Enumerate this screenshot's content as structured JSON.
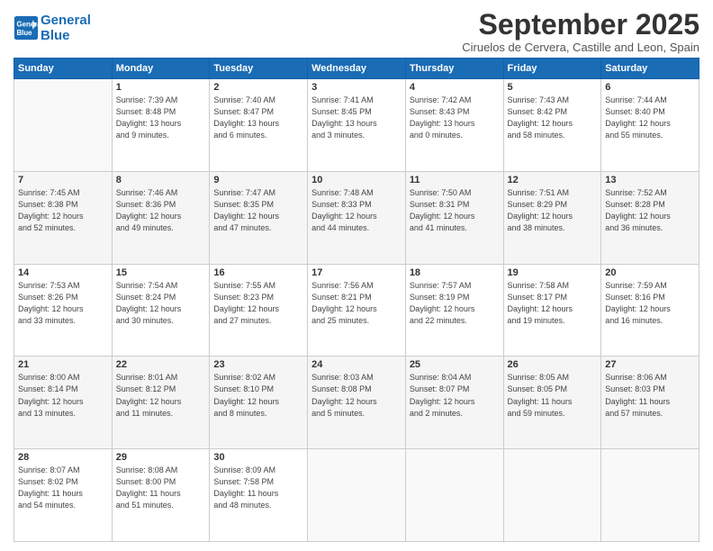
{
  "logo": {
    "line1": "General",
    "line2": "Blue"
  },
  "title": "September 2025",
  "location": "Ciruelos de Cervera, Castille and Leon, Spain",
  "weekdays": [
    "Sunday",
    "Monday",
    "Tuesday",
    "Wednesday",
    "Thursday",
    "Friday",
    "Saturday"
  ],
  "weeks": [
    [
      {
        "day": "",
        "info": ""
      },
      {
        "day": "1",
        "info": "Sunrise: 7:39 AM\nSunset: 8:48 PM\nDaylight: 13 hours\nand 9 minutes."
      },
      {
        "day": "2",
        "info": "Sunrise: 7:40 AM\nSunset: 8:47 PM\nDaylight: 13 hours\nand 6 minutes."
      },
      {
        "day": "3",
        "info": "Sunrise: 7:41 AM\nSunset: 8:45 PM\nDaylight: 13 hours\nand 3 minutes."
      },
      {
        "day": "4",
        "info": "Sunrise: 7:42 AM\nSunset: 8:43 PM\nDaylight: 13 hours\nand 0 minutes."
      },
      {
        "day": "5",
        "info": "Sunrise: 7:43 AM\nSunset: 8:42 PM\nDaylight: 12 hours\nand 58 minutes."
      },
      {
        "day": "6",
        "info": "Sunrise: 7:44 AM\nSunset: 8:40 PM\nDaylight: 12 hours\nand 55 minutes."
      }
    ],
    [
      {
        "day": "7",
        "info": "Sunrise: 7:45 AM\nSunset: 8:38 PM\nDaylight: 12 hours\nand 52 minutes."
      },
      {
        "day": "8",
        "info": "Sunrise: 7:46 AM\nSunset: 8:36 PM\nDaylight: 12 hours\nand 49 minutes."
      },
      {
        "day": "9",
        "info": "Sunrise: 7:47 AM\nSunset: 8:35 PM\nDaylight: 12 hours\nand 47 minutes."
      },
      {
        "day": "10",
        "info": "Sunrise: 7:48 AM\nSunset: 8:33 PM\nDaylight: 12 hours\nand 44 minutes."
      },
      {
        "day": "11",
        "info": "Sunrise: 7:50 AM\nSunset: 8:31 PM\nDaylight: 12 hours\nand 41 minutes."
      },
      {
        "day": "12",
        "info": "Sunrise: 7:51 AM\nSunset: 8:29 PM\nDaylight: 12 hours\nand 38 minutes."
      },
      {
        "day": "13",
        "info": "Sunrise: 7:52 AM\nSunset: 8:28 PM\nDaylight: 12 hours\nand 36 minutes."
      }
    ],
    [
      {
        "day": "14",
        "info": "Sunrise: 7:53 AM\nSunset: 8:26 PM\nDaylight: 12 hours\nand 33 minutes."
      },
      {
        "day": "15",
        "info": "Sunrise: 7:54 AM\nSunset: 8:24 PM\nDaylight: 12 hours\nand 30 minutes."
      },
      {
        "day": "16",
        "info": "Sunrise: 7:55 AM\nSunset: 8:23 PM\nDaylight: 12 hours\nand 27 minutes."
      },
      {
        "day": "17",
        "info": "Sunrise: 7:56 AM\nSunset: 8:21 PM\nDaylight: 12 hours\nand 25 minutes."
      },
      {
        "day": "18",
        "info": "Sunrise: 7:57 AM\nSunset: 8:19 PM\nDaylight: 12 hours\nand 22 minutes."
      },
      {
        "day": "19",
        "info": "Sunrise: 7:58 AM\nSunset: 8:17 PM\nDaylight: 12 hours\nand 19 minutes."
      },
      {
        "day": "20",
        "info": "Sunrise: 7:59 AM\nSunset: 8:16 PM\nDaylight: 12 hours\nand 16 minutes."
      }
    ],
    [
      {
        "day": "21",
        "info": "Sunrise: 8:00 AM\nSunset: 8:14 PM\nDaylight: 12 hours\nand 13 minutes."
      },
      {
        "day": "22",
        "info": "Sunrise: 8:01 AM\nSunset: 8:12 PM\nDaylight: 12 hours\nand 11 minutes."
      },
      {
        "day": "23",
        "info": "Sunrise: 8:02 AM\nSunset: 8:10 PM\nDaylight: 12 hours\nand 8 minutes."
      },
      {
        "day": "24",
        "info": "Sunrise: 8:03 AM\nSunset: 8:08 PM\nDaylight: 12 hours\nand 5 minutes."
      },
      {
        "day": "25",
        "info": "Sunrise: 8:04 AM\nSunset: 8:07 PM\nDaylight: 12 hours\nand 2 minutes."
      },
      {
        "day": "26",
        "info": "Sunrise: 8:05 AM\nSunset: 8:05 PM\nDaylight: 11 hours\nand 59 minutes."
      },
      {
        "day": "27",
        "info": "Sunrise: 8:06 AM\nSunset: 8:03 PM\nDaylight: 11 hours\nand 57 minutes."
      }
    ],
    [
      {
        "day": "28",
        "info": "Sunrise: 8:07 AM\nSunset: 8:02 PM\nDaylight: 11 hours\nand 54 minutes."
      },
      {
        "day": "29",
        "info": "Sunrise: 8:08 AM\nSunset: 8:00 PM\nDaylight: 11 hours\nand 51 minutes."
      },
      {
        "day": "30",
        "info": "Sunrise: 8:09 AM\nSunset: 7:58 PM\nDaylight: 11 hours\nand 48 minutes."
      },
      {
        "day": "",
        "info": ""
      },
      {
        "day": "",
        "info": ""
      },
      {
        "day": "",
        "info": ""
      },
      {
        "day": "",
        "info": ""
      }
    ]
  ]
}
